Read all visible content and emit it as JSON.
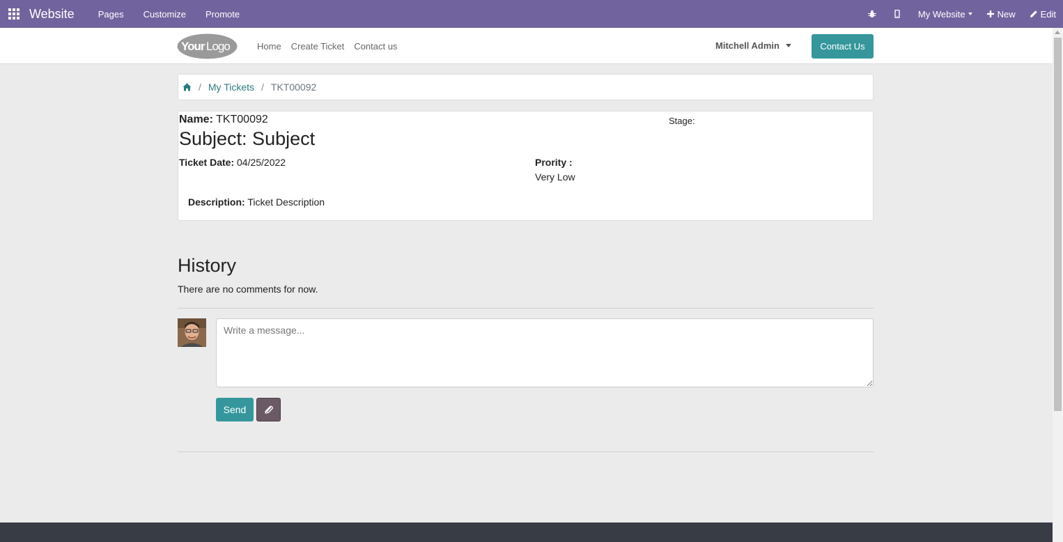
{
  "admin_bar": {
    "app_name": "Website",
    "menu": [
      "Pages",
      "Customize",
      "Promote"
    ],
    "website_selector": "My Website",
    "new_label": "New",
    "edit_label": "Edit"
  },
  "header": {
    "logo_text": "YourLogo",
    "nav": [
      "Home",
      "Create Ticket",
      "Contact us"
    ],
    "user_name": "Mitchell Admin",
    "contact_button": "Contact Us"
  },
  "breadcrumb": {
    "link": "My Tickets",
    "current": "TKT00092"
  },
  "ticket": {
    "name_label": "Name:",
    "name_value": "TKT00092",
    "stage_label": "Stage:",
    "subject": "Subject: Subject",
    "date_label": "Ticket Date:",
    "date_value": "04/25/2022",
    "priority_label": "Prority :",
    "priority_value": "Very Low",
    "description_label": "Description:",
    "description_value": "Ticket Description"
  },
  "history": {
    "title": "History",
    "empty_text": "There are no comments for now.",
    "message_placeholder": "Write a message...",
    "send_label": "Send"
  },
  "colors": {
    "admin_bar": "#71639e",
    "primary": "#35979c",
    "link": "#2c7a7f",
    "footer": "#383c44"
  }
}
